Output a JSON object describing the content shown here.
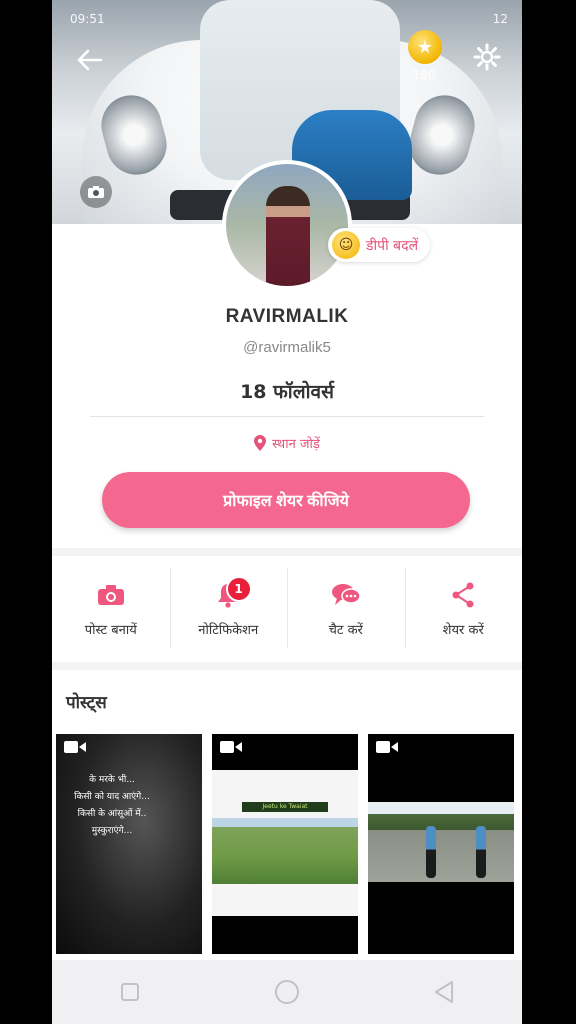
{
  "status_bar": {
    "time": "09:51",
    "right": "12"
  },
  "cover": {
    "coin_count": "180"
  },
  "profile": {
    "dp_change_label": "डीपी बदलें",
    "username": "RAVIRMALIK",
    "handle": "@ravirmalik5",
    "followers": "18 फॉलोवर्स",
    "location_label": "स्थान जोड़ें",
    "share_button": "प्रोफाइल शेयर कीजिये"
  },
  "actions": [
    {
      "label": "पोस्ट बनायें",
      "icon": "camera-icon"
    },
    {
      "label": "नोटिफिकेशन",
      "icon": "bell-icon",
      "badge": "1"
    },
    {
      "label": "चैट करें",
      "icon": "chat-icon"
    },
    {
      "label": "शेयर करें",
      "icon": "share-icon"
    }
  ],
  "posts": {
    "title": "पोस्ट्स",
    "items": [
      {
        "type": "video",
        "caption": [
          "के मरके भी...",
          "किसी को याद आएंगे...",
          "किसी के आंसूओं में..",
          "मुस्कुराएंगे..."
        ]
      },
      {
        "type": "video",
        "banner": "Jeetu ke Twaiat"
      },
      {
        "type": "video"
      }
    ]
  },
  "colors": {
    "accent": "#f4688f",
    "accent_text": "#e5527a",
    "badge": "#e8203b"
  },
  "navbar": [
    "square-icon",
    "circle-icon",
    "triangle-back-icon"
  ]
}
